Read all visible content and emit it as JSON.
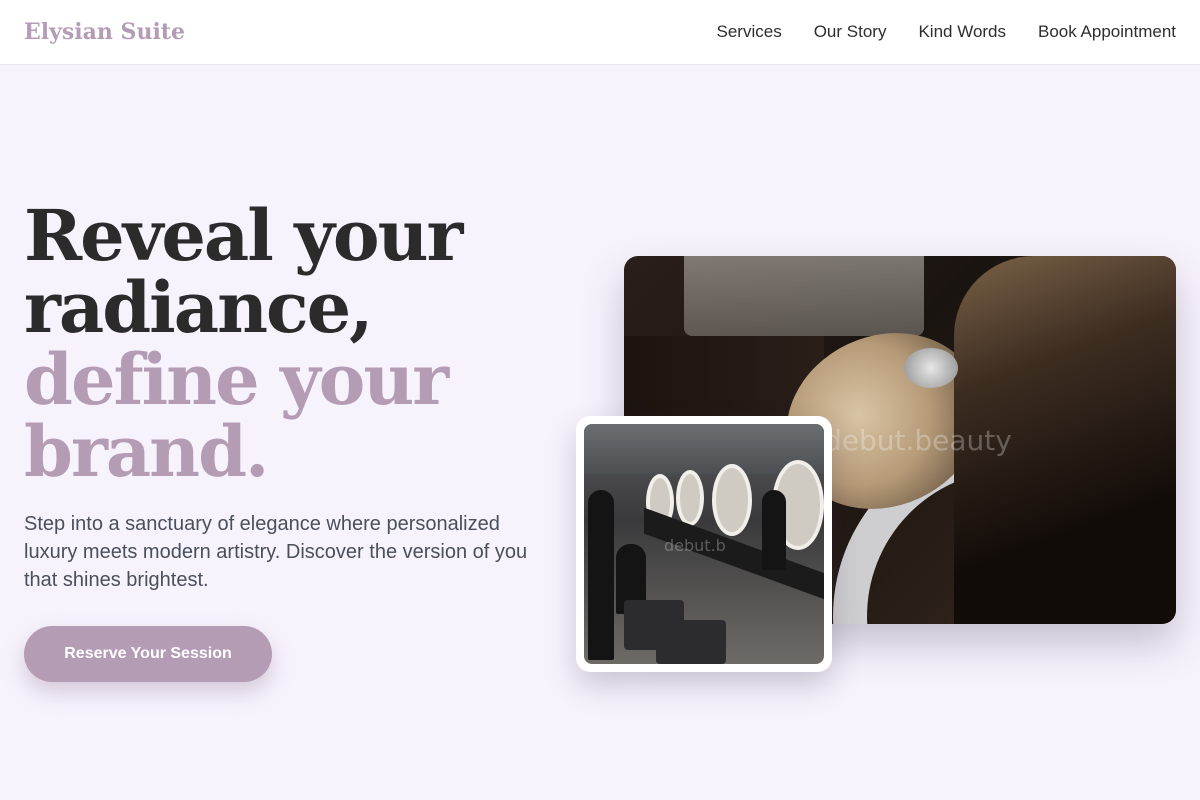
{
  "header": {
    "brand": "Elysian Suite",
    "nav": [
      "Services",
      "Our Story",
      "Kind Words",
      "Book Appointment"
    ]
  },
  "hero": {
    "title_lines": [
      "Reveal your",
      "radiance,"
    ],
    "title_accent_lines": [
      "define your",
      "brand."
    ],
    "subtitle": "Step into a sanctuary of elegance where personalized luxury meets modern artistry. Discover the version of you that shines brightest.",
    "cta_label": "Reserve Your Session"
  },
  "images": {
    "main_watermark": "debut.beauty",
    "small_watermark": "debut.b"
  },
  "colors": {
    "accent": "#b59cb5",
    "background": "#f7f3fc",
    "text": "#2b2b2b"
  }
}
